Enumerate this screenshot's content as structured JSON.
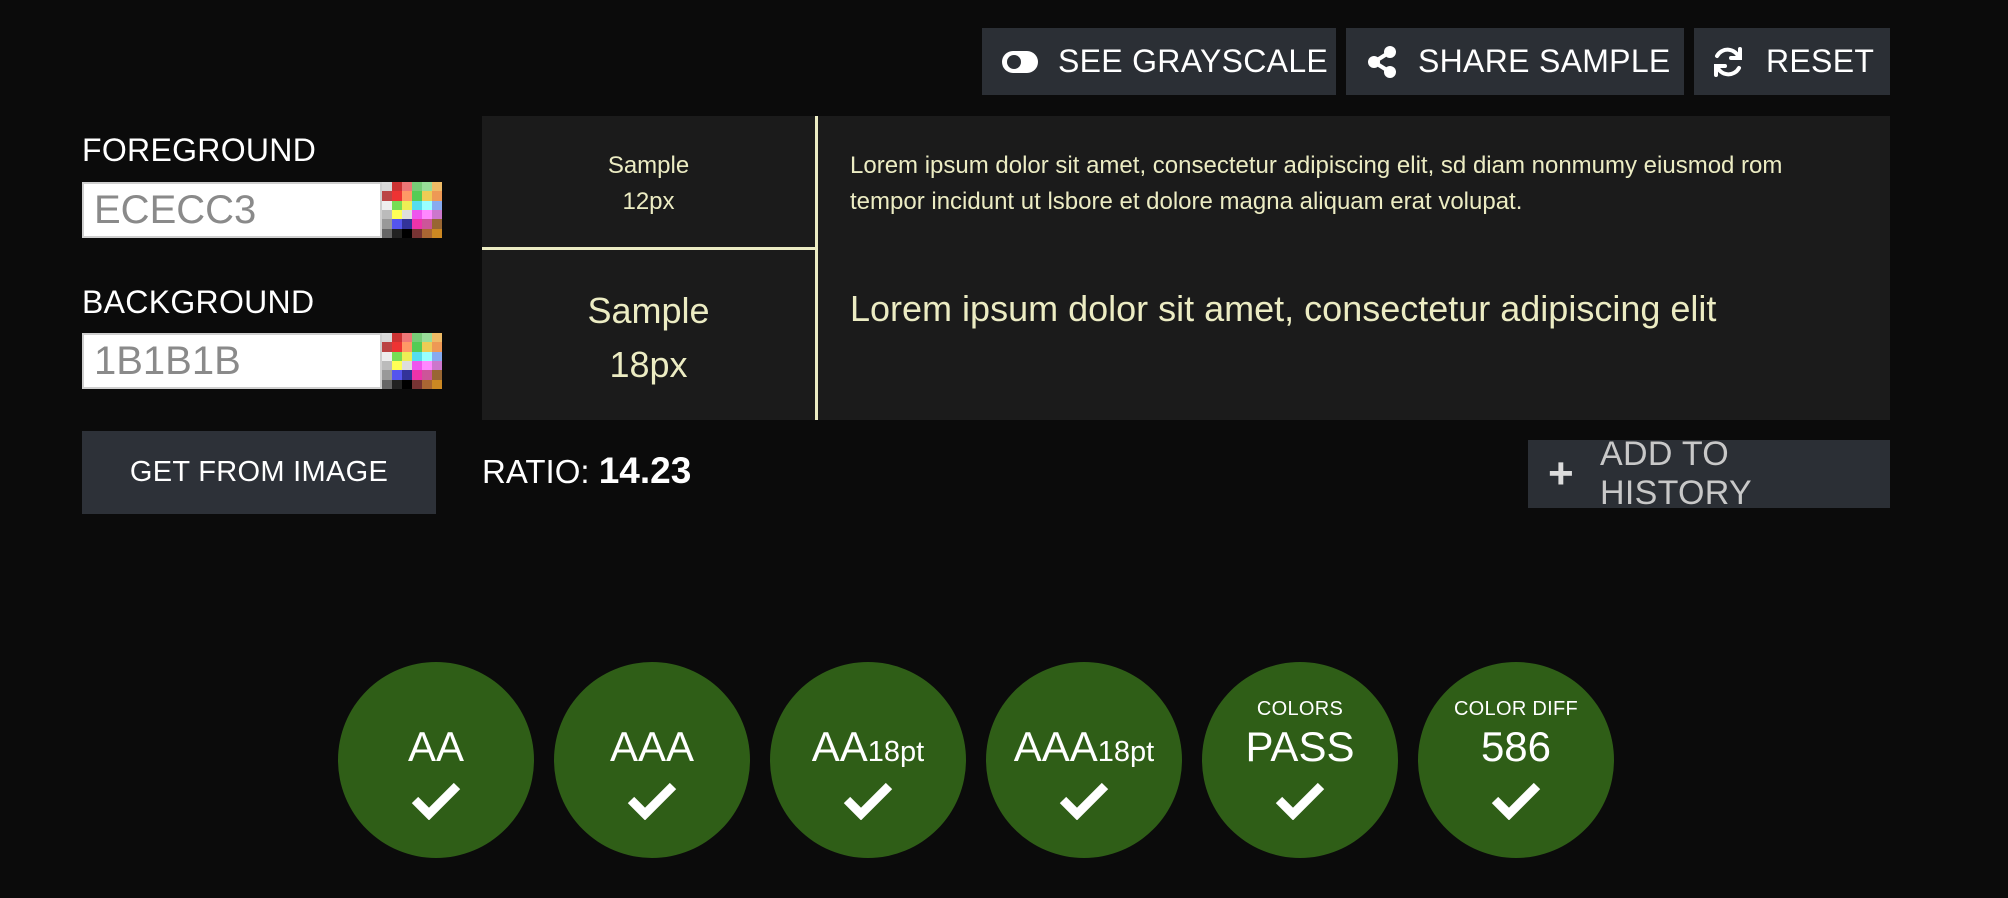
{
  "toolbar": {
    "grayscale_label": "SEE GRAYSCALE",
    "share_label": "SHARE SAMPLE",
    "reset_label": "RESET"
  },
  "colors_panel": {
    "foreground_label": "FOREGROUND",
    "foreground_value": "ECECC3",
    "background_label": "BACKGROUND",
    "background_value": "1B1B1B",
    "get_from_image_label": "GET FROM IMAGE"
  },
  "sample": {
    "small_label_line1": "Sample",
    "small_label_line2": "12px",
    "small_text": "Lorem ipsum dolor sit amet, consectetur adipiscing elit, sd diam nonmumy eiusmod rom tempor incidunt ut lsbore et dolore magna aliquam erat volupat.",
    "large_label_line1": "Sample",
    "large_label_line2": "18px",
    "large_text": "Lorem ipsum dolor sit amet, consectetur adipiscing elit"
  },
  "ratio": {
    "label": "RATIO:",
    "value": "14.23"
  },
  "history": {
    "add_label": "ADD TO HISTORY"
  },
  "results": {
    "aa": "AA",
    "aaa": "AAA",
    "aa18_main": "AA",
    "aa18_sub": "18pt",
    "aaa18_main": "AAA",
    "aaa18_sub": "18pt",
    "colors_top": "COLORS",
    "colors_main": "PASS",
    "diff_top": "COLOR DIFF",
    "diff_main": "586"
  },
  "theme": {
    "page_background": "#0b0b0b",
    "panel_background": "#1b1b1b",
    "foreground": "#ececc3",
    "button_background": "#2b2f35",
    "pass_green": "#2f5e17"
  },
  "icons": [
    "toggle-icon",
    "share-icon",
    "refresh-icon",
    "palette-icon",
    "plus-icon",
    "check-icon"
  ]
}
